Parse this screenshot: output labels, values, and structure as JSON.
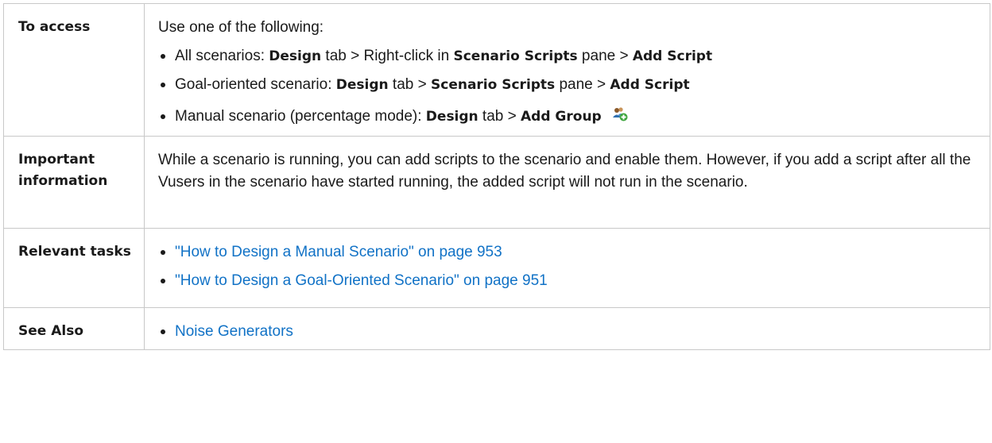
{
  "access": {
    "label": "To access",
    "intro": "Use one of the following:",
    "items": [
      {
        "prefix": "All scenarios: ",
        "kw1": "Design",
        "mid1": " tab > Right-click in ",
        "kw2": "Scenario Scripts",
        "mid2": " pane > ",
        "kw3": "Add Script"
      },
      {
        "prefix": "Goal-oriented scenario: ",
        "kw1": "Design",
        "mid1": " tab > ",
        "kw2": "Scenario Scripts",
        "mid2": " pane > ",
        "kw3": "Add Script"
      },
      {
        "prefix": "Manual scenario (percentage mode): ",
        "kw1": "Design",
        "mid1": " tab > ",
        "kw2": "Add Group",
        "icon": "add-group-icon"
      }
    ]
  },
  "important": {
    "label": "Important information",
    "text": "While a scenario is running, you can add scripts to the scenario and enable them. However, if you add a script after all the Vusers in the scenario have started running, the added script will not run in the scenario."
  },
  "relevant": {
    "label": "Relevant tasks",
    "links": [
      "\"How to Design a Manual Scenario\" on page 953",
      "\"How to Design a Goal-Oriented Scenario\" on page 951"
    ]
  },
  "see_also": {
    "label": "See Also",
    "links": [
      "Noise Generators"
    ]
  },
  "colors": {
    "link": "#1172c6",
    "border": "#c8c8c8",
    "text": "#1a1a1a"
  }
}
